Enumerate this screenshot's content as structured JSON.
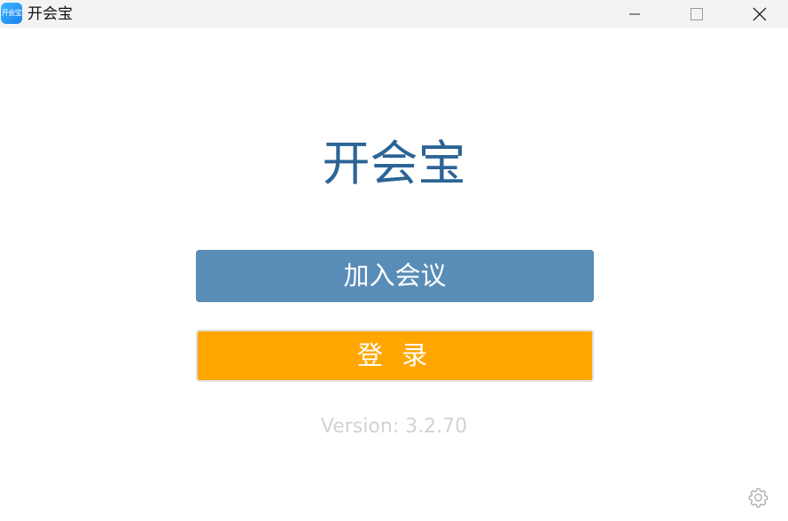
{
  "window": {
    "title": "开会宝",
    "icon_label": "开会宝",
    "icon": "app-logo-icon",
    "controls": [
      "minimize-icon",
      "maximize-icon",
      "close-icon"
    ]
  },
  "main": {
    "heading": "开会宝",
    "join_button_label": "加入会议",
    "login_button_label": "登 录",
    "version": "Version: 3.2.70"
  },
  "footer": {
    "settings_icon": "gear-icon"
  },
  "colors": {
    "titlebar": "#f3f3f1",
    "heading": "#2c6496",
    "join_button": "#598db8",
    "login_button": "#ffa600",
    "version_text": "#d2d2d2"
  }
}
